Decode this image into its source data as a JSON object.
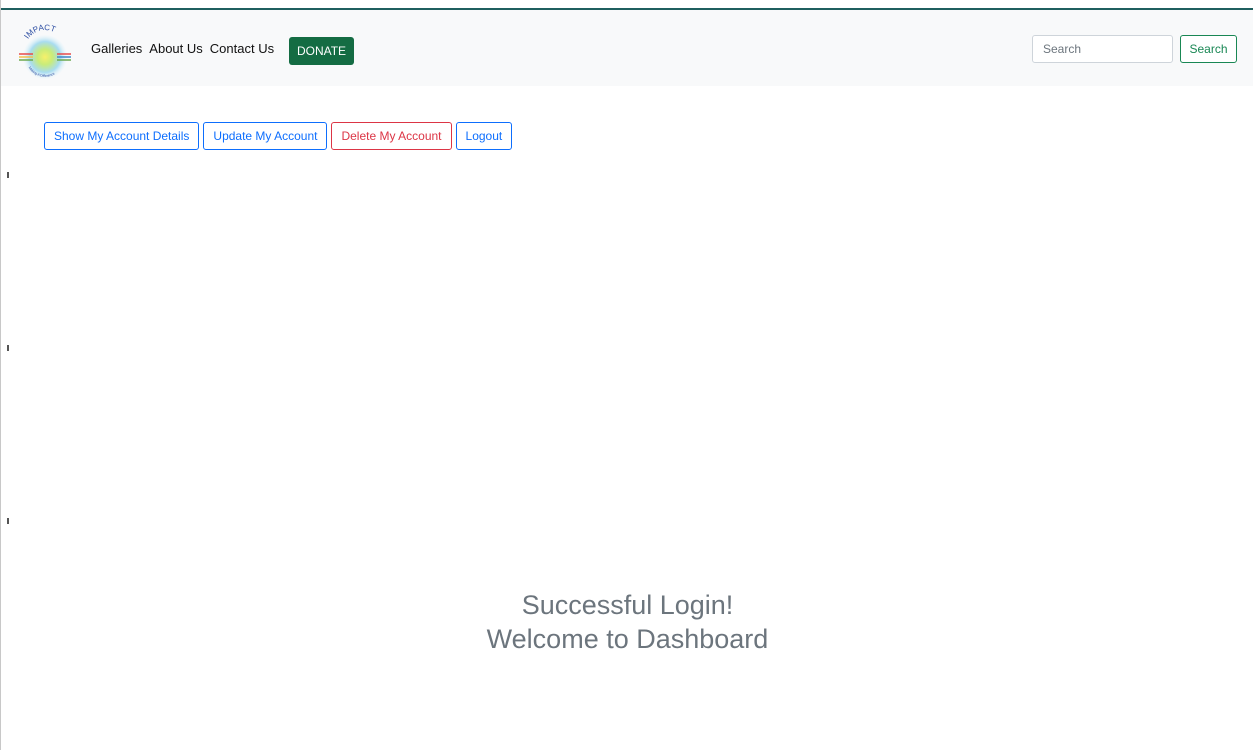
{
  "brand": {
    "logo_text": "IMPACT",
    "logo_tagline": "Making A Difference"
  },
  "nav": {
    "links": [
      "Galleries",
      "About Us",
      "Contact Us"
    ],
    "donate_label": "DONATE"
  },
  "search": {
    "placeholder": "Search",
    "value": "",
    "button_label": "Search"
  },
  "account_actions": {
    "show_details": "Show My Account Details",
    "update": "Update My Account",
    "delete": "Delete My Account",
    "logout": "Logout"
  },
  "message": {
    "line1": "Successful Login!",
    "line2": "Welcome to Dashboard"
  },
  "colors": {
    "donate": "#146c43",
    "search_button": "#198754",
    "primary": "#0d6efd",
    "danger": "#dc3545",
    "message_text": "#6c757d",
    "navbar_bg": "#f8f9fa"
  }
}
